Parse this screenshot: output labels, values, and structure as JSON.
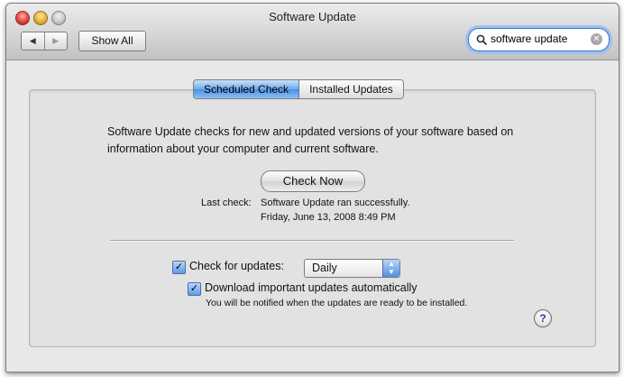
{
  "window": {
    "title": "Software Update"
  },
  "toolbar": {
    "back_icon": "back-arrow-icon",
    "forward_icon": "forward-arrow-icon",
    "show_all_label": "Show All"
  },
  "search": {
    "value": "software update",
    "icon": "magnifier-icon",
    "clear_icon": "clear-circle-icon"
  },
  "tabs": [
    {
      "label": "Scheduled Check",
      "active": true
    },
    {
      "label": "Installed Updates",
      "active": false
    }
  ],
  "scheduled": {
    "description": "Software Update checks for new and updated versions of your software based on information about your computer and current software.",
    "check_now_label": "Check Now",
    "last_check_label": "Last check:",
    "last_check_status": "Software Update ran successfully.",
    "last_check_date": "Friday, June 13, 2008 8:49 PM",
    "check_updates_label": "Check for updates:",
    "check_updates_checked": true,
    "frequency_value": "Daily",
    "download_label": "Download important updates automatically",
    "download_checked": true,
    "download_hint": "You will be notified when the updates are ready to be installed."
  },
  "help": {
    "label": "?"
  },
  "colors": {
    "accent": "#4b8fe3",
    "help_glyph": "#5a1f9e"
  }
}
